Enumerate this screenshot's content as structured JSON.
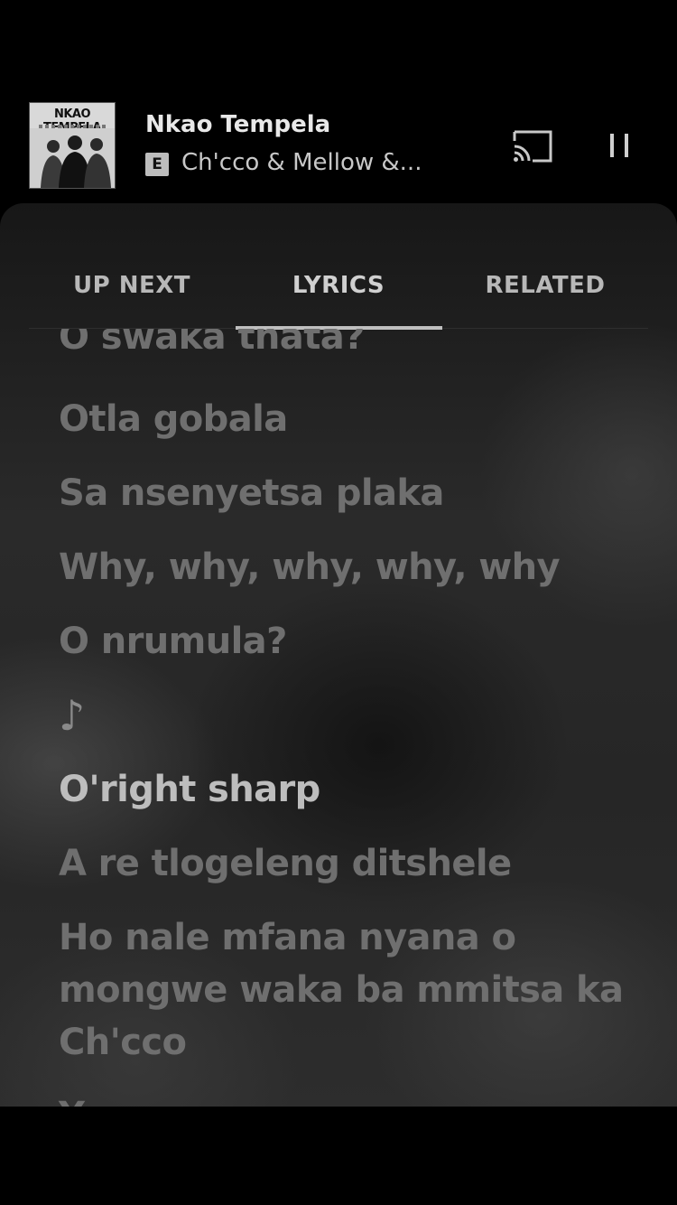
{
  "player": {
    "album_art_text": "NKAO TEMPELA",
    "title": "Nkao Tempela",
    "explicit_badge": "E",
    "artist": "Ch'cco & Mellow &...",
    "cast_icon": "cast-icon",
    "pause_icon": "pause-icon"
  },
  "tabs": [
    {
      "label": "UP NEXT",
      "active": false
    },
    {
      "label": "LYRICS",
      "active": true
    },
    {
      "label": "RELATED",
      "active": false
    }
  ],
  "lyrics": [
    {
      "text": "O swaka thata?",
      "state": "past"
    },
    {
      "text": "Otla gobala",
      "state": "past"
    },
    {
      "text": "Sa nsenyetsa plaka",
      "state": "past"
    },
    {
      "text": "Why, why, why, why, why",
      "state": "past"
    },
    {
      "text": "O nrumula?",
      "state": "past"
    },
    {
      "text": "♪",
      "state": "note"
    },
    {
      "text": "O'right sharp",
      "state": "current"
    },
    {
      "text": "A re tlogeleng ditshele",
      "state": "upcoming"
    },
    {
      "text": "Ho nale mfana nyana o mongwe waka ba mmitsa ka Ch'cco",
      "state": "upcoming"
    },
    {
      "text": "Y",
      "state": "upcoming"
    }
  ]
}
